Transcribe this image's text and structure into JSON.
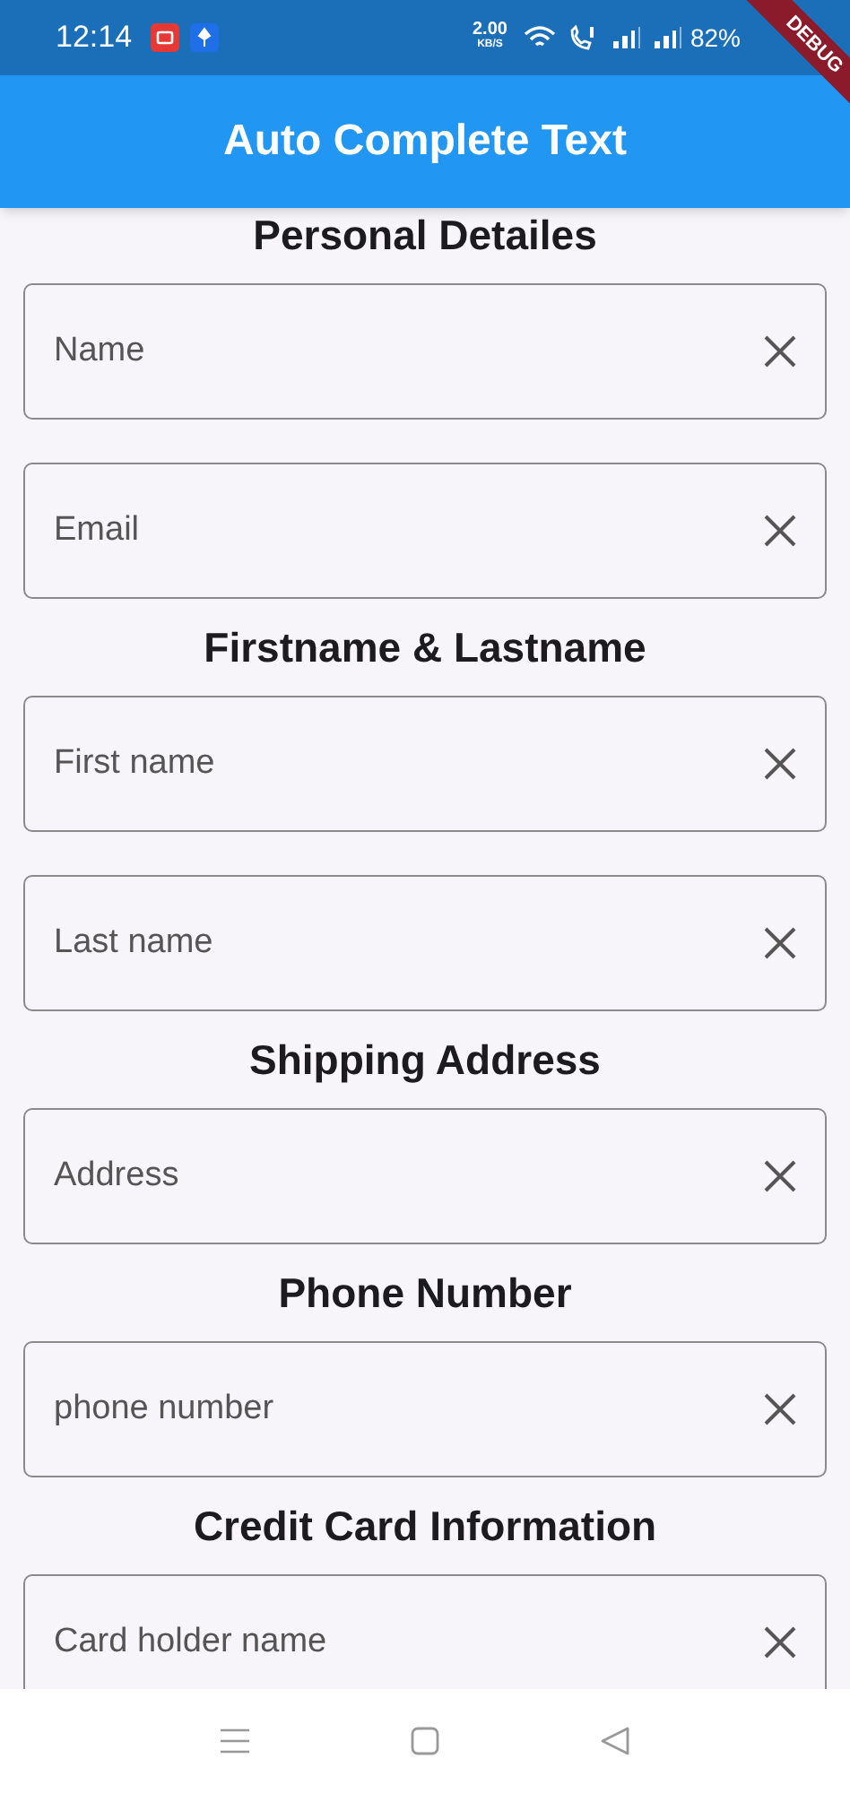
{
  "status_bar": {
    "time": "12:14",
    "speed": "2.00",
    "speed_unit": "KB/S",
    "battery": "82%"
  },
  "debug_banner": "DEBUG",
  "app_bar": {
    "title": "Auto Complete Text"
  },
  "sections": [
    {
      "heading": "Personal Detailes",
      "fields": [
        {
          "placeholder": "Name"
        },
        {
          "placeholder": "Email"
        }
      ]
    },
    {
      "heading": "Firstname & Lastname",
      "fields": [
        {
          "placeholder": "First name"
        },
        {
          "placeholder": "Last name"
        }
      ]
    },
    {
      "heading": "Shipping Address",
      "fields": [
        {
          "placeholder": "Address"
        }
      ]
    },
    {
      "heading": "Phone Number",
      "fields": [
        {
          "placeholder": "phone number"
        }
      ]
    },
    {
      "heading": "Credit Card Information",
      "fields": [
        {
          "placeholder": "Card holder name"
        }
      ]
    }
  ]
}
